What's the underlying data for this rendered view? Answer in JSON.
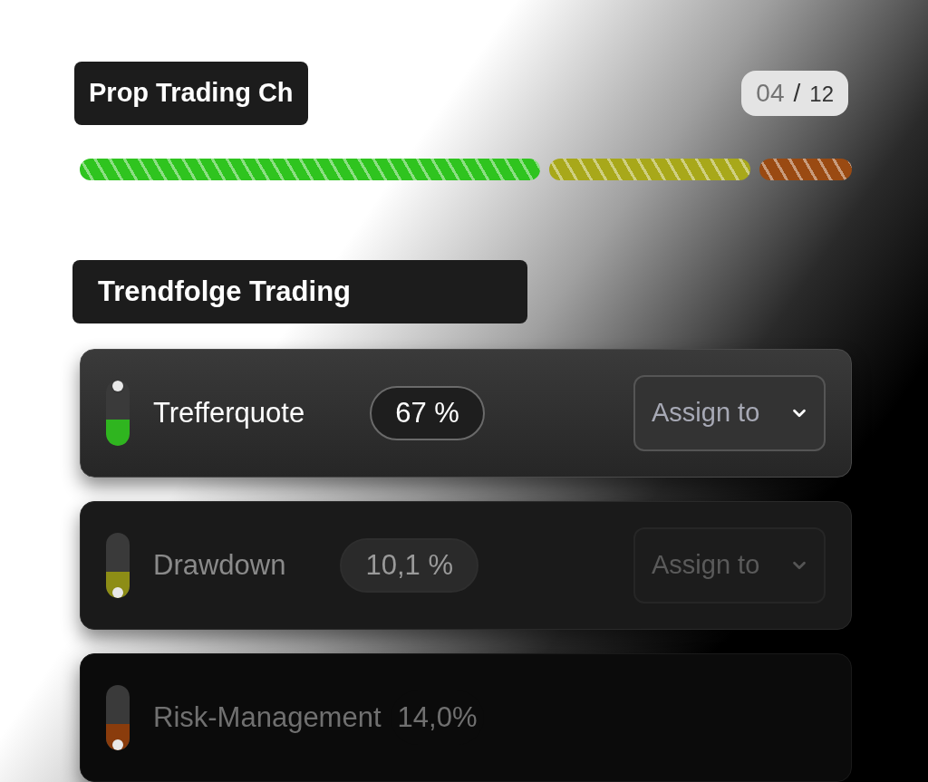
{
  "header": {
    "title": "Prop Trading Ch",
    "counter_current": "04",
    "counter_separator": "/",
    "counter_total": "12"
  },
  "progress": {
    "segments": [
      {
        "color": "#2fc41f"
      },
      {
        "color": "#a8a81a"
      },
      {
        "color": "#9a4a12"
      }
    ]
  },
  "section": {
    "title": "Trendfolge Trading"
  },
  "rows": [
    {
      "name": "Trefferquote",
      "value": "67 %",
      "indicator": {
        "color": "#2fb51f",
        "level": 1
      },
      "assign": "Assign to"
    },
    {
      "name": "Drawdown",
      "value": "10,1 %",
      "indicator": {
        "color": "#8d8d16",
        "level": 0
      },
      "assign": "Assign to"
    },
    {
      "name": "Risk-Management",
      "value": "14,0%",
      "indicator": {
        "color": "#8a3c0c",
        "level": 0
      }
    }
  ]
}
